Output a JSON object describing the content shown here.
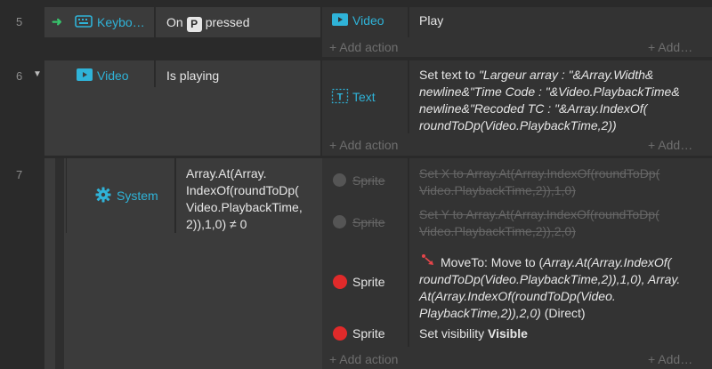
{
  "events": {
    "e5": {
      "number": "5",
      "condition": {
        "object": "Keybo…",
        "pre": "On",
        "key": "P",
        "post": "pressed"
      },
      "action": {
        "object": "Video",
        "text": "Play"
      },
      "add_action": "+ Add action",
      "add_other": "+ Add…"
    },
    "e6": {
      "number": "6",
      "condition": {
        "object": "Video",
        "text": "Is playing"
      },
      "action": {
        "object": "Text",
        "prefix": "Set text to ",
        "lines": [
          "\"Largeur array : \"&Array.Width&",
          "newline&\"Time Code : \"&Video.PlaybackTime&",
          "newline&\"Recoded TC : \"&Array.IndexOf(",
          "roundToDp(Video.PlaybackTime,2))"
        ]
      },
      "add_action": "+ Add action",
      "add_other": "+ Add…"
    },
    "e7": {
      "number": "7",
      "condition": {
        "object": "System",
        "lines": [
          "Array.At(Array.",
          "IndexOf(roundToDp(",
          "Video.PlaybackTime,",
          "2)),1,0) ≠ 0"
        ]
      },
      "actions": [
        {
          "object": "Sprite",
          "lines": [
            "Set X to Array.At(Array.IndexOf(roundToDp(",
            "Video.PlaybackTime,2)),1,0)"
          ]
        },
        {
          "object": "Sprite",
          "lines": [
            "Set Y to Array.At(Array.IndexOf(roundToDp(",
            "Video.PlaybackTime,2)),2,0)"
          ]
        },
        {
          "object": "Sprite",
          "first": "MoveTo: Move to (",
          "first_it": "Array.At(Array.IndexOf(",
          "lines": [
            "roundToDp(Video.PlaybackTime,2)),1,0), Array.",
            "At(Array.IndexOf(roundToDp(Video.",
            "PlaybackTime,2)),2,0)"
          ],
          "tail": " (Direct)"
        },
        {
          "object": "Sprite",
          "text": "Set visibility ",
          "bold": "Visible"
        }
      ],
      "add_action": "+ Add action",
      "add_other": "+ Add…"
    }
  },
  "colors": {
    "accent": "#2fb3d8",
    "green_arrow": "#38c26b",
    "sprite_red": "#e02a2a",
    "move_icon": "#e5454a"
  }
}
